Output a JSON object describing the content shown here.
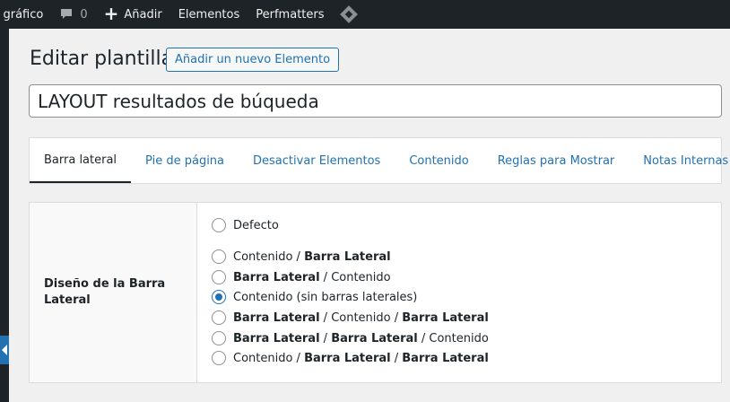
{
  "adminbar": {
    "item1": "r gráfico",
    "comments_count": "0",
    "new_label": "Añadir",
    "elements_label": "Elementos",
    "perfmatters_label": "Perfmatters"
  },
  "page": {
    "title": "Editar plantilla",
    "add_new_label": "Añadir un nuevo Elemento",
    "element_title": "LAYOUT resultados de búqueda"
  },
  "tabs": [
    {
      "label": "Barra lateral",
      "active": true
    },
    {
      "label": "Pie de página",
      "active": false
    },
    {
      "label": "Desactivar Elementos",
      "active": false
    },
    {
      "label": "Contenido",
      "active": false
    },
    {
      "label": "Reglas para Mostrar",
      "active": false
    },
    {
      "label": "Notas Internas",
      "active": false
    }
  ],
  "sidebar_layout": {
    "label": "Diseño de la Barra Lateral",
    "selected": "Contenido (sin barras laterales)",
    "options": [
      {
        "a": "Defecto"
      },
      {
        "a": "Contenido",
        "sep1": " / ",
        "b": "Barra Lateral"
      },
      {
        "a": "Barra Lateral",
        "sep1": " / ",
        "b": "Contenido"
      },
      {
        "a": "Contenido (sin barras laterales)"
      },
      {
        "a": "Barra Lateral",
        "sep1": " / ",
        "b": "Contenido",
        "sep2": " / ",
        "c": "Barra Lateral"
      },
      {
        "a": "Barra Lateral",
        "sep1": " / ",
        "b": "Barra Lateral",
        "sep2": " / ",
        "c": "Contenido"
      },
      {
        "a": "Contenido",
        "sep1": " / ",
        "b": "Barra Lateral",
        "sep2": " / ",
        "c": "Barra Lateral"
      }
    ]
  },
  "icons": {
    "comments": "speech-bubble-icon",
    "new": "plus-icon",
    "perfmatters": "diamond-icon",
    "collapse": "collapse-arrow-icon"
  },
  "colors": {
    "accent": "#2271b1",
    "adminbar": "#1d2327"
  }
}
